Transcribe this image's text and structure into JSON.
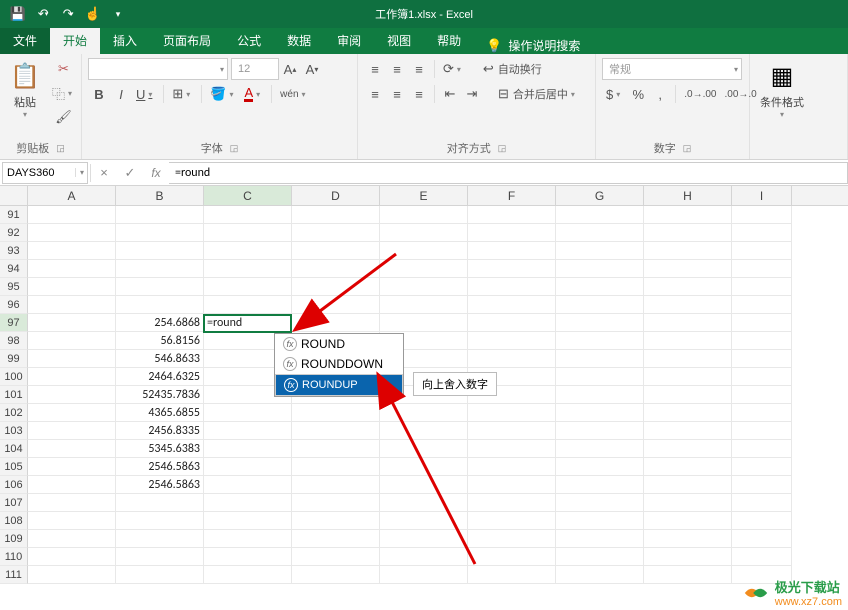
{
  "app": {
    "title": "工作簿1.xlsx - Excel"
  },
  "tabs": {
    "file": "文件",
    "home": "开始",
    "insert": "插入",
    "layout": "页面布局",
    "formulas": "公式",
    "data": "数据",
    "review": "审阅",
    "view": "视图",
    "help": "帮助",
    "tellme": "操作说明搜索"
  },
  "ribbon": {
    "clipboard": {
      "label": "剪贴板",
      "paste": "粘贴"
    },
    "font": {
      "label": "字体",
      "name_ph": "",
      "size_ph": "12",
      "bold": "B",
      "italic": "I",
      "underline": "U"
    },
    "align": {
      "label": "对齐方式",
      "wrap": "自动换行",
      "merge": "合并后居中"
    },
    "number": {
      "label": "数字",
      "general": "常规"
    },
    "styles": {
      "cond": "条件格式"
    }
  },
  "formula_bar": {
    "namebox": "DAYS360",
    "cancel": "×",
    "confirm": "✓",
    "value": "=round"
  },
  "grid": {
    "cols": [
      "A",
      "B",
      "C",
      "D",
      "E",
      "F",
      "G",
      "H",
      "I"
    ],
    "rows_first": "91",
    "b_values": [
      "254.6868",
      "56.8156",
      "546.8633",
      "2464.6325",
      "52435.7836",
      "4365.6855",
      "2456.8335",
      "5345.6383",
      "2546.5863",
      "2546.5863"
    ],
    "c7_value": "=round"
  },
  "autocomplete": {
    "items": [
      "ROUND",
      "ROUNDDOWN",
      "ROUNDUP"
    ],
    "tip": "向上舍入数字"
  },
  "watermark": {
    "text": "极光下载站",
    "url": "www.xz7.com"
  }
}
